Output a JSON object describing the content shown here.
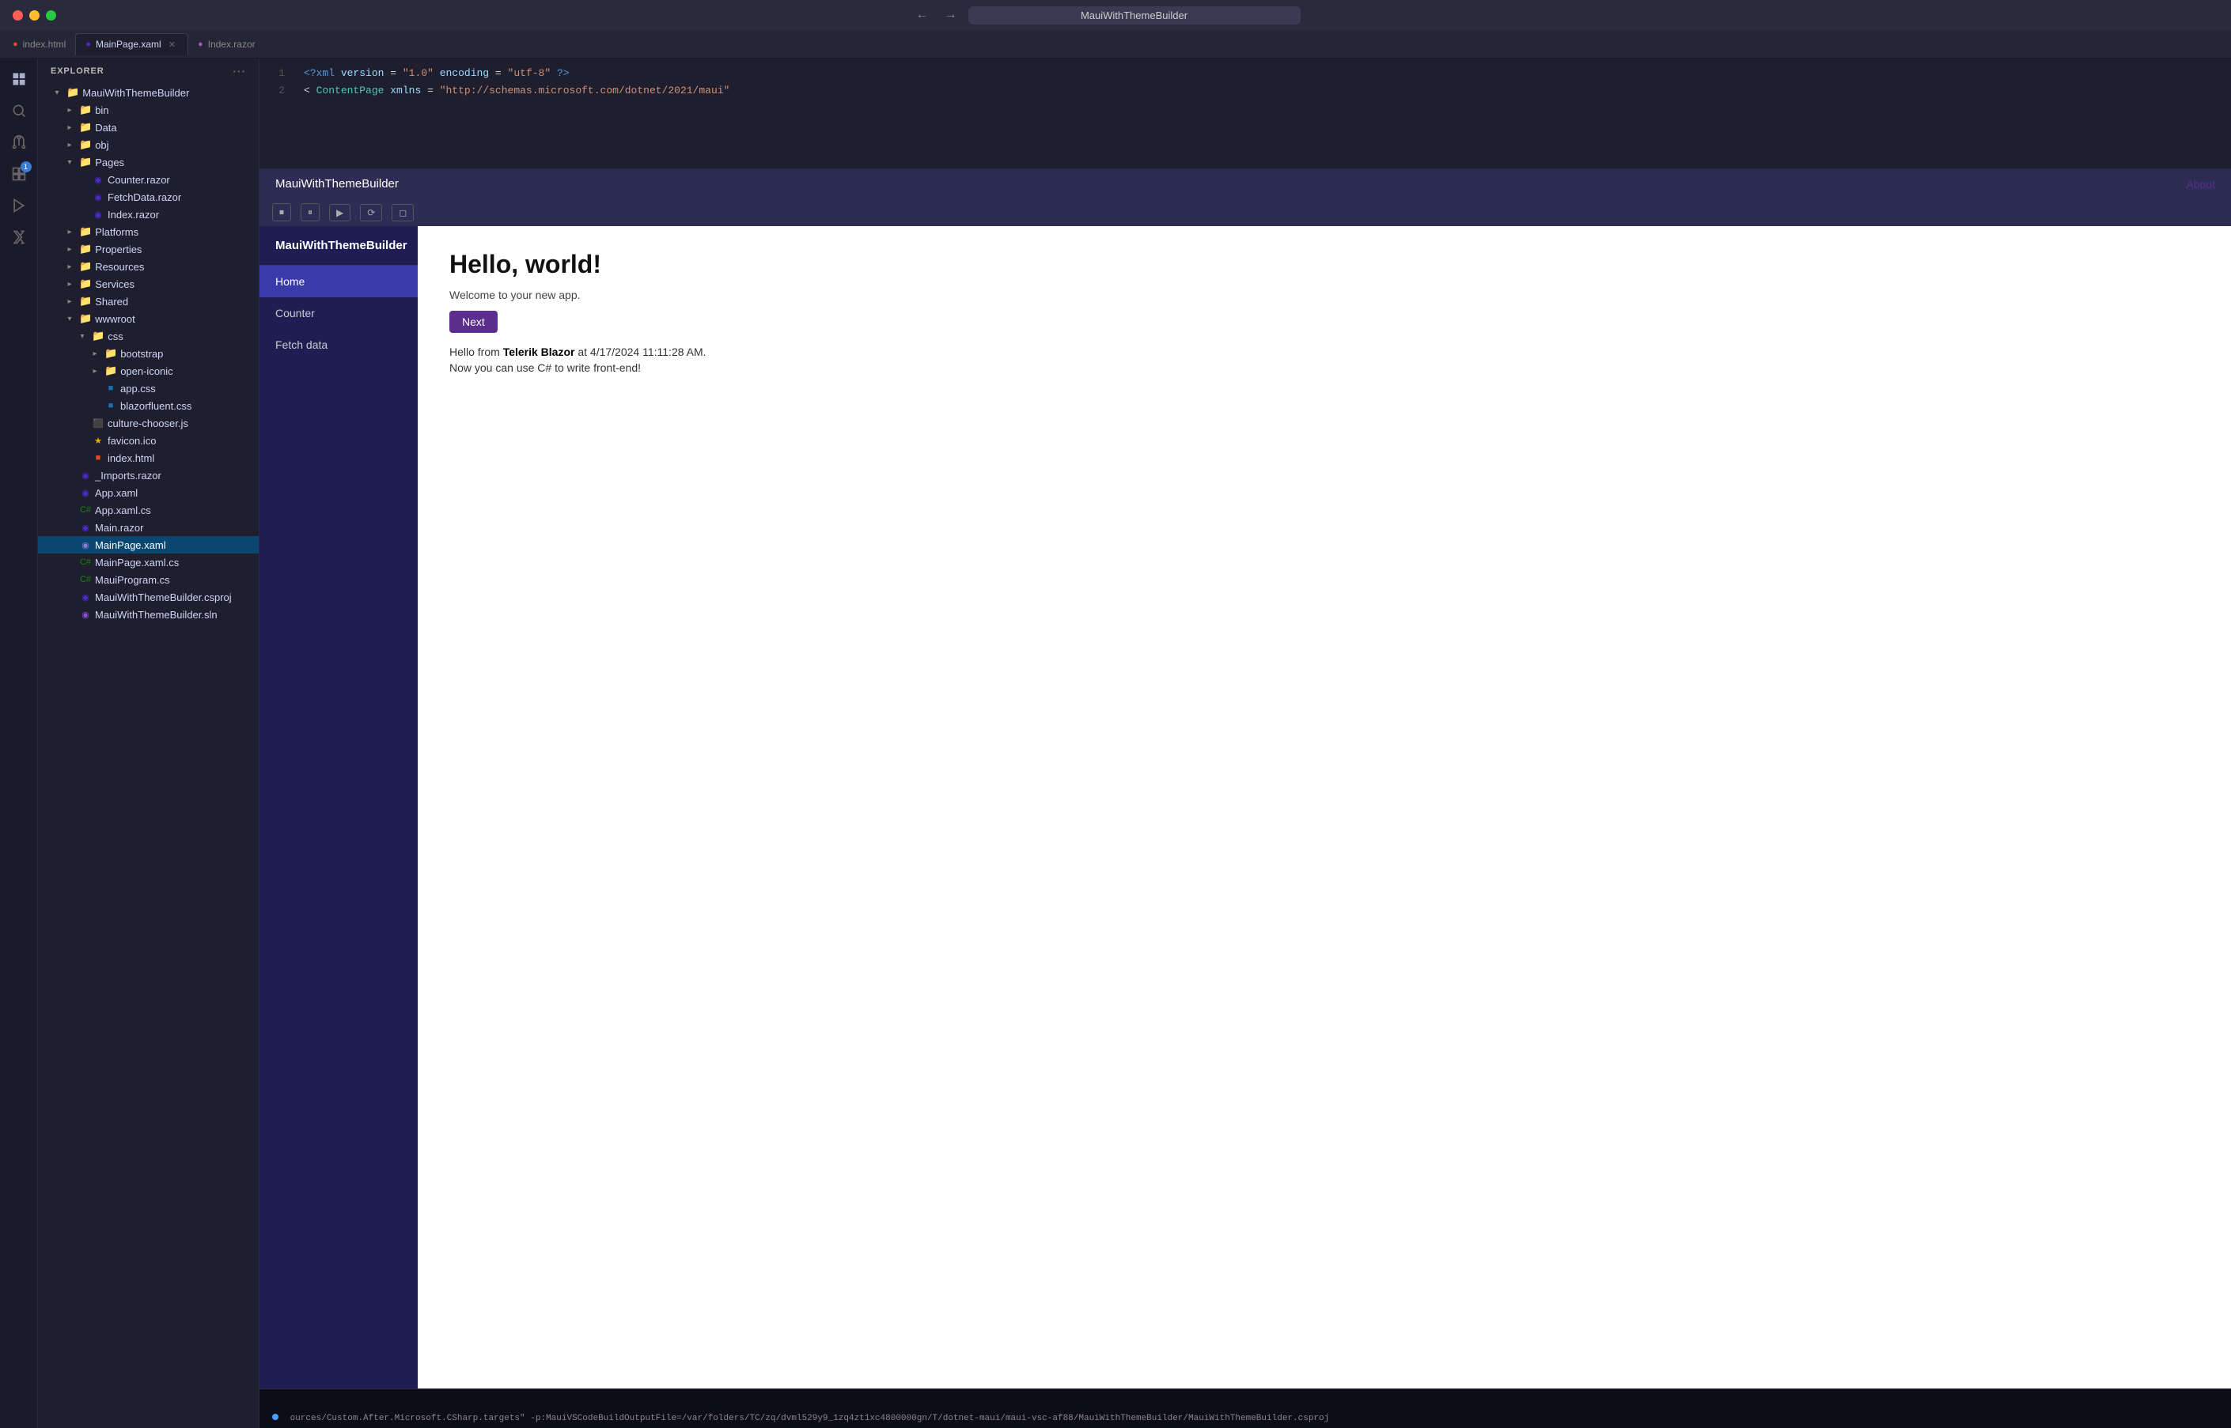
{
  "titleBar": {
    "appName": "MauiWithThemeBuilder",
    "navBack": "←",
    "navForward": "→"
  },
  "tabs": [
    {
      "id": "index-html",
      "label": "index.html",
      "iconType": "html",
      "active": false,
      "closable": false
    },
    {
      "id": "mainpage-xaml",
      "label": "MainPage.xaml",
      "iconType": "xaml",
      "active": true,
      "closable": true
    },
    {
      "id": "index-razor",
      "label": "Index.razor",
      "iconType": "razor",
      "active": false,
      "closable": false
    }
  ],
  "activityBar": {
    "icons": [
      {
        "id": "explorer",
        "symbol": "⎇",
        "active": true,
        "badge": null
      },
      {
        "id": "search",
        "symbol": "🔍",
        "active": false,
        "badge": null
      },
      {
        "id": "source-control",
        "symbol": "⑂",
        "active": false,
        "badge": null
      },
      {
        "id": "extensions",
        "symbol": "⊞",
        "active": false,
        "badge": "1"
      },
      {
        "id": "run",
        "symbol": "▷",
        "active": false,
        "badge": null
      },
      {
        "id": "flask",
        "symbol": "⚗",
        "active": false,
        "badge": null
      }
    ]
  },
  "explorer": {
    "title": "EXPLORER",
    "rootName": "MAUIWITHTHEMEBUILDER",
    "tree": {
      "rootFolder": "MauiWithThemeBuilder",
      "items": [
        {
          "id": "bin",
          "label": "bin",
          "type": "folder",
          "indent": 2,
          "expanded": false
        },
        {
          "id": "data",
          "label": "Data",
          "type": "folder",
          "indent": 2,
          "expanded": false
        },
        {
          "id": "obj",
          "label": "obj",
          "type": "folder",
          "indent": 2,
          "expanded": false
        },
        {
          "id": "pages",
          "label": "Pages",
          "type": "folder",
          "indent": 2,
          "expanded": true
        },
        {
          "id": "counter-razor",
          "label": "Counter.razor",
          "type": "razor",
          "indent": 3
        },
        {
          "id": "fetchdata-razor",
          "label": "FetchData.razor",
          "type": "razor",
          "indent": 3
        },
        {
          "id": "index-razor-file",
          "label": "Index.razor",
          "type": "razor",
          "indent": 3
        },
        {
          "id": "platforms",
          "label": "Platforms",
          "type": "folder",
          "indent": 2,
          "expanded": false
        },
        {
          "id": "properties",
          "label": "Properties",
          "type": "folder",
          "indent": 2,
          "expanded": false
        },
        {
          "id": "resources",
          "label": "Resources",
          "type": "folder",
          "indent": 2,
          "expanded": false
        },
        {
          "id": "services",
          "label": "Services",
          "type": "folder",
          "indent": 2,
          "expanded": false
        },
        {
          "id": "shared",
          "label": "Shared",
          "type": "folder",
          "indent": 2,
          "expanded": false
        },
        {
          "id": "wwwroot",
          "label": "wwwroot",
          "type": "folder",
          "indent": 2,
          "expanded": true
        },
        {
          "id": "css",
          "label": "css",
          "type": "folder",
          "indent": 3,
          "expanded": true
        },
        {
          "id": "bootstrap",
          "label": "bootstrap",
          "type": "folder",
          "indent": 4,
          "expanded": false
        },
        {
          "id": "open-iconic",
          "label": "open-iconic",
          "type": "folder",
          "indent": 4,
          "expanded": false
        },
        {
          "id": "app-css",
          "label": "app.css",
          "type": "css",
          "indent": 4
        },
        {
          "id": "blazorfluent-css",
          "label": "blazorfluent.css",
          "type": "css",
          "indent": 4
        },
        {
          "id": "culture-chooser",
          "label": "culture-chooser.js",
          "type": "js",
          "indent": 3
        },
        {
          "id": "favicon-ico",
          "label": "favicon.ico",
          "type": "ico",
          "indent": 3
        },
        {
          "id": "index-html-file",
          "label": "index.html",
          "type": "html",
          "indent": 3
        },
        {
          "id": "imports-razor",
          "label": "_Imports.razor",
          "type": "razor",
          "indent": 2
        },
        {
          "id": "app-xaml",
          "label": "App.xaml",
          "type": "xaml",
          "indent": 2
        },
        {
          "id": "app-xaml-cs",
          "label": "App.xaml.cs",
          "type": "cs",
          "indent": 2
        },
        {
          "id": "main-razor",
          "label": "Main.razor",
          "type": "razor",
          "indent": 2
        },
        {
          "id": "mainpage-xaml-file",
          "label": "MainPage.xaml",
          "type": "xaml",
          "indent": 2,
          "selected": true
        },
        {
          "id": "mainpage-xaml-cs",
          "label": "MainPage.xaml.cs",
          "type": "cs",
          "indent": 2
        },
        {
          "id": "mauiprogram-cs",
          "label": "MauiProgram.cs",
          "type": "cs",
          "indent": 2
        },
        {
          "id": "maui-csproj",
          "label": "MauiWithThemeBuilder.csproj",
          "type": "csproj",
          "indent": 2
        },
        {
          "id": "maui-sln",
          "label": "MauiWithThemeBuilder.sln",
          "type": "sln",
          "indent": 2
        }
      ]
    }
  },
  "codeEditor": {
    "lines": [
      {
        "num": 1,
        "content": "<?xml version=\"1.0\" encoding=\"utf-8\" ?>"
      },
      {
        "num": 2,
        "content": "<ContentPage xmlns=\"http://schemas.microsoft.com/dotnet/2021/maui\""
      }
    ]
  },
  "mauiWindow": {
    "title": "MauiWithThemeBuilder",
    "aboutLabel": "About",
    "toolbar": {
      "buttons": [
        "⏹",
        "⏸",
        "▶",
        "⟳",
        "◻"
      ]
    },
    "blazorApp": {
      "appTitle": "MauiWithThemeBuilder",
      "navItems": [
        {
          "id": "home",
          "label": "Home",
          "active": true
        },
        {
          "id": "counter",
          "label": "Counter",
          "active": false
        },
        {
          "id": "fetch-data",
          "label": "Fetch data",
          "active": false
        }
      ],
      "mainContent": {
        "heading": "Hello, world!",
        "welcomeText": "Welcome to your new app.",
        "nextButtonLabel": "Next",
        "telerikLine": "Hello from Telerik Blazor at 4/17/2024 11:11:28 AM.",
        "telerikBold": "Telerik Blazor",
        "noteLine": "Now you can use C# to write front-end!"
      }
    }
  },
  "terminal": {
    "text": "ources/Custom.After.Microsoft.CSharp.targets\" -p:MauiVSCodeBuildOutputFile=/var/folders/TC/zq/dvml529y9_1zq4zt1xc4800000gn/T/dotnet-maui/maui-vsc-af88/MauiWithThemeBuilder/MauiWithThemeBuilder.csproj"
  },
  "fileIconColors": {
    "html": "#e44d26",
    "razor": "#512bd4",
    "xaml": "#512bd4",
    "cs": "#178600",
    "css": "#1572b6",
    "js": "#f7df1e",
    "ico": "#f5a623",
    "csproj": "#512bd4",
    "sln": "#512bd4",
    "folder": "#dcb67a",
    "folderSpecial": "#e8704a"
  }
}
